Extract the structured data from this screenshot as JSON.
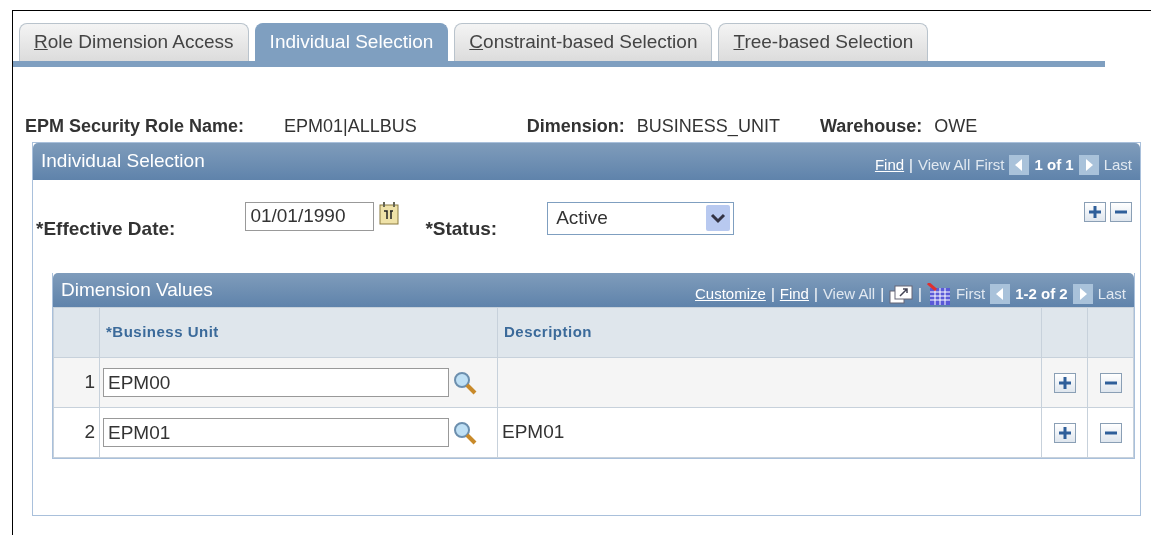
{
  "tabs": [
    {
      "label": "Role Dimension Access",
      "selected": false,
      "underline_first": true
    },
    {
      "label": "Individual Selection",
      "selected": true,
      "underline_first": false
    },
    {
      "label": "Constraint-based Selection",
      "selected": false,
      "underline_first": true
    },
    {
      "label": "Tree-based Selection",
      "selected": false,
      "underline_first": true
    }
  ],
  "header_fields": [
    {
      "label": "EPM Security Role Name:",
      "value": "EPM01|ALLBUS"
    },
    {
      "label": "Dimension:",
      "value": "BUSINESS_UNIT"
    },
    {
      "label": "Warehouse:",
      "value": "OWE"
    }
  ],
  "individual_selection": {
    "title": "Individual Selection",
    "nav": [
      {
        "kind": "link",
        "text": "Find",
        "disabled": false
      },
      {
        "kind": "separator",
        "text": "|"
      },
      {
        "kind": "link",
        "text": "View All",
        "disabled": true
      },
      {
        "kind": "link",
        "text": "First",
        "disabled": true
      },
      {
        "kind": "prev"
      },
      {
        "kind": "counter",
        "text": "1 of 1"
      },
      {
        "kind": "next"
      },
      {
        "kind": "link",
        "text": "Last",
        "disabled": true
      }
    ],
    "effective_date": {
      "label": "*Effective Date:",
      "value": "01/01/1990"
    },
    "status": {
      "label": "*Status:",
      "value": "Active"
    },
    "dimension_values": {
      "title": "Dimension Values",
      "nav": [
        {
          "kind": "link",
          "text": "Customize",
          "disabled": false
        },
        {
          "kind": "separator",
          "text": "|"
        },
        {
          "kind": "link",
          "text": "Find",
          "disabled": false
        },
        {
          "kind": "separator",
          "text": "|"
        },
        {
          "kind": "link",
          "text": "View All",
          "disabled": true
        },
        {
          "kind": "separator",
          "text": "|"
        },
        {
          "kind": "zoom"
        },
        {
          "kind": "separator",
          "text": "|"
        },
        {
          "kind": "download"
        },
        {
          "kind": "link",
          "text": "First",
          "disabled": true
        },
        {
          "kind": "prev"
        },
        {
          "kind": "counter",
          "text": "1-2 of 2"
        },
        {
          "kind": "next"
        },
        {
          "kind": "link",
          "text": "Last",
          "disabled": true
        }
      ],
      "columns": [
        "*Business Unit",
        "Description"
      ],
      "rows": [
        {
          "number": "1",
          "business_unit": "EPM00"
        },
        {
          "number": "2",
          "business_unit": "EPM01",
          "description": "EPM01"
        }
      ]
    }
  }
}
